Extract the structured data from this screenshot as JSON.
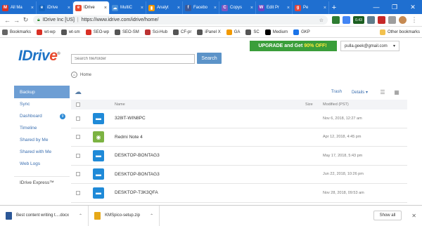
{
  "browser": {
    "tabs": [
      {
        "label": "All Ma",
        "color": "#d93025",
        "glyph": "M"
      },
      {
        "label": "iDrive",
        "color": "#1565c0",
        "glyph": "e"
      },
      {
        "label": "IDrive",
        "color": "#e84a2e",
        "glyph": "e",
        "active": true
      },
      {
        "label": "MultiC",
        "color": "#4a90d9",
        "glyph": "☁"
      },
      {
        "label": "Analyt",
        "color": "#f29900",
        "glyph": "▮"
      },
      {
        "label": "Facebo",
        "color": "#3b5998",
        "glyph": "f"
      },
      {
        "label": "Copys",
        "color": "#7e57c2",
        "glyph": "C"
      },
      {
        "label": "Edit Pr",
        "color": "#6f42c1",
        "glyph": "W"
      },
      {
        "label": "Pe",
        "color": "#e0443a",
        "glyph": "g"
      }
    ],
    "address": {
      "site": "IDrive Inc [US]",
      "url": "https://www.idrive.com/idrive/home/"
    },
    "bookmarks": [
      {
        "label": "Bookmarks",
        "color": "#666"
      },
      {
        "label": "wt-wp",
        "color": "#d93025"
      },
      {
        "label": "wt-sm",
        "color": "#555"
      },
      {
        "label": "SEO-wp",
        "color": "#d93025"
      },
      {
        "label": "SEO-SM",
        "color": "#555"
      },
      {
        "label": "Sci-Hub",
        "color": "#b33"
      },
      {
        "label": "CF-pr",
        "color": "#555"
      },
      {
        "label": "iPanel X",
        "color": "#555"
      },
      {
        "label": "GA",
        "color": "#f29900"
      },
      {
        "label": "SC",
        "color": "#555"
      },
      {
        "label": "Medium",
        "color": "#000"
      },
      {
        "label": "GKP",
        "color": "#1a73e8"
      }
    ],
    "other_bookmarks": "Other bookmarks",
    "ext_badge": "0.43"
  },
  "header": {
    "logo_text": "IDriv",
    "logo_e": "e",
    "search_placeholder": "Search file/folder",
    "search_button": "Search",
    "upgrade_pre": "UPGRADE and Get",
    "upgrade_hi": "90% OFF!",
    "user_email": "pulla.geek@gmail.com"
  },
  "breadcrumb": "Home",
  "sidebar": {
    "items": [
      {
        "label": "Backup",
        "active": true
      },
      {
        "label": "Sync"
      },
      {
        "label": "Dashboard",
        "badge": "9"
      },
      {
        "label": "Timeline"
      },
      {
        "label": "Shared by Me"
      },
      {
        "label": "Shared with Me"
      },
      {
        "label": "Web Logs"
      }
    ],
    "express": "IDrive Express™"
  },
  "toolbar": {
    "trash": "Trash",
    "details": "Details"
  },
  "table": {
    "headers": {
      "name": "Name",
      "size": "Size",
      "modified": "Modified (PST)"
    },
    "rows": [
      {
        "name": "328IT-WIN8PC",
        "date": "Nov 6, 2018, 12:27 am",
        "kind": "folder"
      },
      {
        "name": "Redmi Note 4",
        "date": "Apr 12, 2018, 4:45 pm",
        "kind": "android"
      },
      {
        "name": "DESKTOP-BONTAG3",
        "date": "May 17, 2018, 5:43 pm",
        "kind": "folder"
      },
      {
        "name": "DESKTOP-BONTAG3",
        "date": "Jun 22, 2018, 10:26 pm",
        "kind": "folder"
      },
      {
        "name": "DESKTOP-T3K3QFA",
        "date": "Nov 28, 2018, 09:53 am",
        "kind": "folder"
      }
    ]
  },
  "downloads": {
    "items": [
      {
        "label": "Best content writing t....docx",
        "color": "#2b5797"
      },
      {
        "label": "KMSpico-setup.zip",
        "color": "#e6a817"
      }
    ],
    "show_all": "Show all"
  },
  "colors": {
    "folder": "#1f8ad8",
    "android": "#7cb342",
    "accent": "#3b6fb0"
  }
}
